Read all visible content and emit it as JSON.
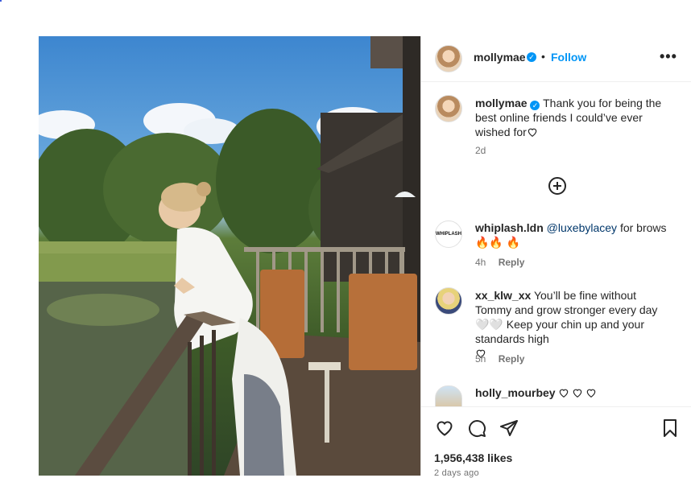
{
  "post": {
    "author": "mollymae",
    "follow_label": "Follow",
    "separator": "•",
    "more_label": "•••",
    "caption": {
      "author": "mollymae",
      "text": "Thank you for being the best online friends I could’ve ever wished for",
      "time": "2d"
    },
    "likes": "1,956,438 likes",
    "date": "2 days ago"
  },
  "comments": [
    {
      "user": "whiplash.ldn",
      "mention": "@luxebylacey",
      "text": "for brows 🔥🔥 🔥",
      "time": "4h",
      "reply_label": "Reply",
      "avatar_label": "WHIPLASH"
    },
    {
      "user": "xx_klw_xx",
      "text": "You’ll be fine without Tommy and grow stronger every day 🤍🤍 Keep your chin up and your standards high",
      "time": "5h",
      "reply_label": "Reply"
    },
    {
      "user": "holly_mourbey",
      "text": ""
    }
  ],
  "colors": {
    "accent": "#0095f6",
    "text": "#262626",
    "muted": "#737373",
    "link": "#00376b"
  },
  "icons": [
    "verified-badge-icon",
    "add-circle-icon",
    "heart-icon",
    "comment-icon",
    "share-icon",
    "bookmark-icon",
    "more-icon"
  ]
}
